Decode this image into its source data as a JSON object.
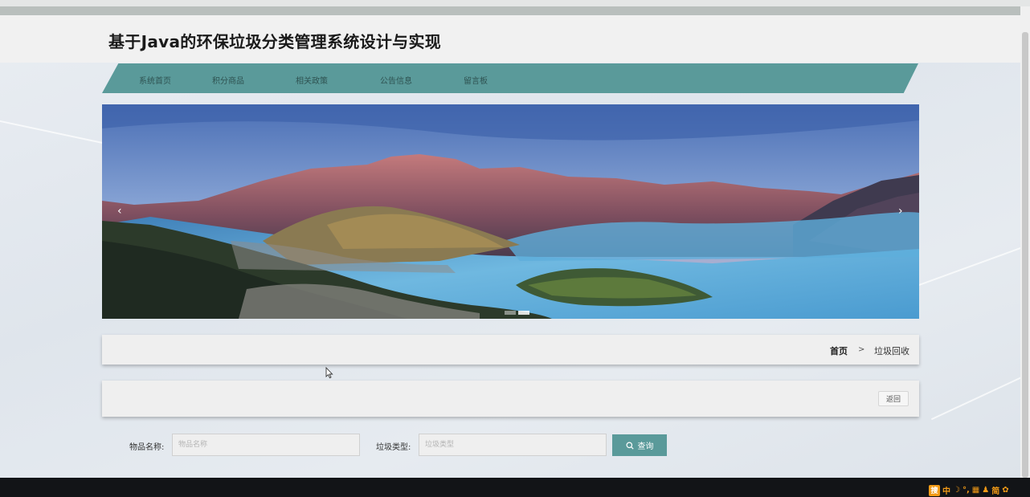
{
  "site": {
    "title": "基于Java的环保垃圾分类管理系统设计与实现"
  },
  "nav": [
    {
      "label": "系统首页"
    },
    {
      "label": "积分商品"
    },
    {
      "label": "相关政策"
    },
    {
      "label": "公告信息"
    },
    {
      "label": "留言板"
    }
  ],
  "carousel": {
    "prev_icon": "‹",
    "next_icon": "›",
    "slide_count": 2,
    "active_index": 1
  },
  "breadcrumb": {
    "home": "首页",
    "separator": ">",
    "current": "垃圾回收"
  },
  "actions": {
    "back_label": "返回"
  },
  "search": {
    "item_name_label": "物品名称:",
    "item_name_placeholder": "物品名称",
    "type_label": "垃圾类型:",
    "type_placeholder": "垃圾类型",
    "query_label": "查询"
  },
  "ime": {
    "logo": "搜",
    "items": [
      "中",
      "☽",
      "°,",
      "▦",
      "♟",
      "简",
      "✿"
    ]
  },
  "colors": {
    "accent": "#5a9a9a",
    "footer": "#121417"
  }
}
